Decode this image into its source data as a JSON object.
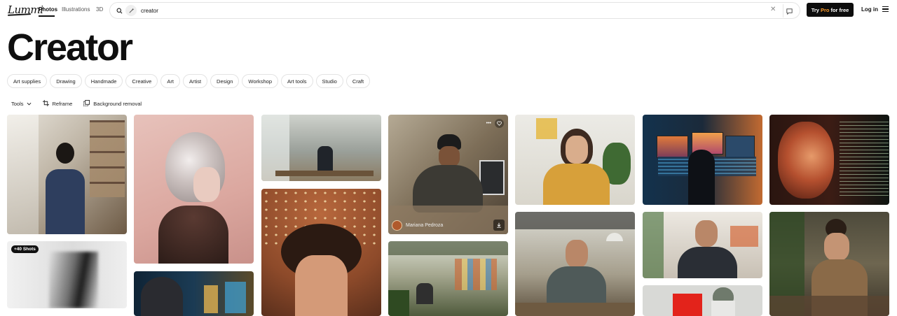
{
  "header": {
    "logo": "Lummi",
    "tabs": [
      {
        "label": "Photos",
        "active": true
      },
      {
        "label": "Illustrations",
        "active": false
      },
      {
        "label": "3D",
        "active": false
      }
    ],
    "search": {
      "value": "creator"
    },
    "pro_button": {
      "prefix": "Try",
      "highlight": "Pro",
      "suffix": "for free"
    },
    "login": "Log in"
  },
  "page_title": "Creator",
  "chips": [
    "Art supplies",
    "Drawing",
    "Handmade",
    "Creative",
    "Art",
    "Artist",
    "Design",
    "Workshop",
    "Art tools",
    "Studio",
    "Craft"
  ],
  "tools": {
    "tools_label": "Tools",
    "reframe_label": "Reframe",
    "bg_removal_label": "Background removal"
  },
  "photos": [
    {
      "name": "photo-woman-apron-workshop",
      "badge": ""
    },
    {
      "name": "photo-dancer-motion-blur",
      "badge": "+40 Shots"
    },
    {
      "name": "photo-glass-headpiece-portrait",
      "badge": ""
    },
    {
      "name": "photo-woman-neon-screens",
      "badge": ""
    },
    {
      "name": "photo-man-studio-desk",
      "badge": ""
    },
    {
      "name": "photo-curly-hair-young-man",
      "badge": ""
    },
    {
      "name": "photo-man-beanie-computer",
      "badge": "",
      "author": "Mariana Pedroza"
    },
    {
      "name": "photo-people-plants-studio",
      "badge": ""
    },
    {
      "name": "photo-woman-glasses-yellow",
      "badge": ""
    },
    {
      "name": "photo-smiling-man-workspace",
      "badge": ""
    },
    {
      "name": "photo-monitors-sunset",
      "badge": ""
    },
    {
      "name": "photo-man-dark-shirt-office",
      "badge": ""
    },
    {
      "name": "photo-red-square-grey-hat",
      "badge": ""
    },
    {
      "name": "photo-woman-projected-light",
      "badge": ""
    },
    {
      "name": "photo-woman-pottery-workshop",
      "badge": ""
    }
  ]
}
